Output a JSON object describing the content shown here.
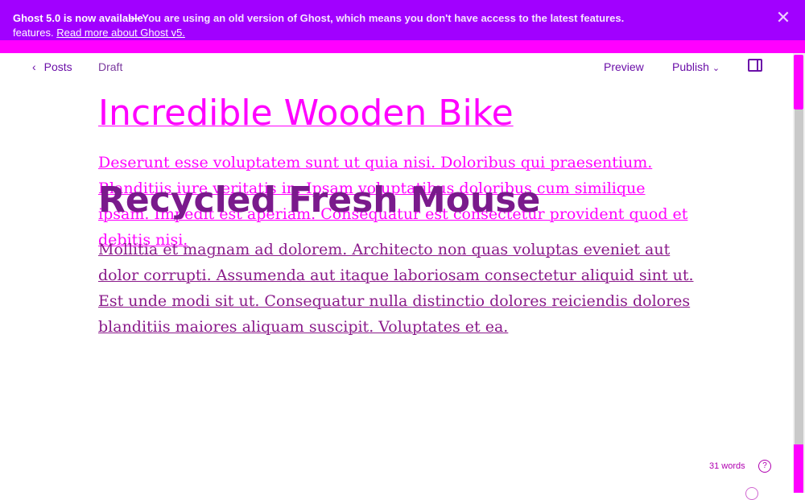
{
  "banner": {
    "line1": "Ghost 5.0 is now available",
    "line1_overlay": "— You are using an old version of Ghost, which means you don't have access to the latest features.",
    "read_more": "Read more",
    "line2_prefix": "features.",
    "line2_link": "Read more about Ghost v5.",
    "close_icon": "close-icon"
  },
  "toolbar": {
    "back_label": "Posts",
    "status": "Draft",
    "preview": "Preview",
    "publish": "Publish",
    "panel_icon": "sidebar-toggle-icon"
  },
  "editor": {
    "title": "Incredible Wooden Bike",
    "overlay_title": "Recycled Fresh Mouse",
    "paragraph1": "Deserunt esse voluptatem sunt ut quia nisi. Doloribus qui praesentium. Blanditiis iure veritatis in. Ipsam voluptatibus doloribus cum similique ipsam. Impedit est aperiam. Consequatur est consectetur provident quod et debitis nisi.",
    "paragraph2": "Mollitia et magnam ad dolorem. Architecto non quas voluptas eveniet aut dolor corrupti. Assumenda aut itaque laboriosam consectetur aliquid sint ut. Est unde modi sit ut. Consequatur nulla distinctio dolores reiciendis dolores blanditiis maiores aliquam suscipit. Voluptates et ea."
  },
  "footer": {
    "word_count": "31 words",
    "help": "?"
  },
  "colors": {
    "banner_bg": "#a100ff",
    "accent": "#ff00ff",
    "text_purple": "#6b0fa8"
  }
}
